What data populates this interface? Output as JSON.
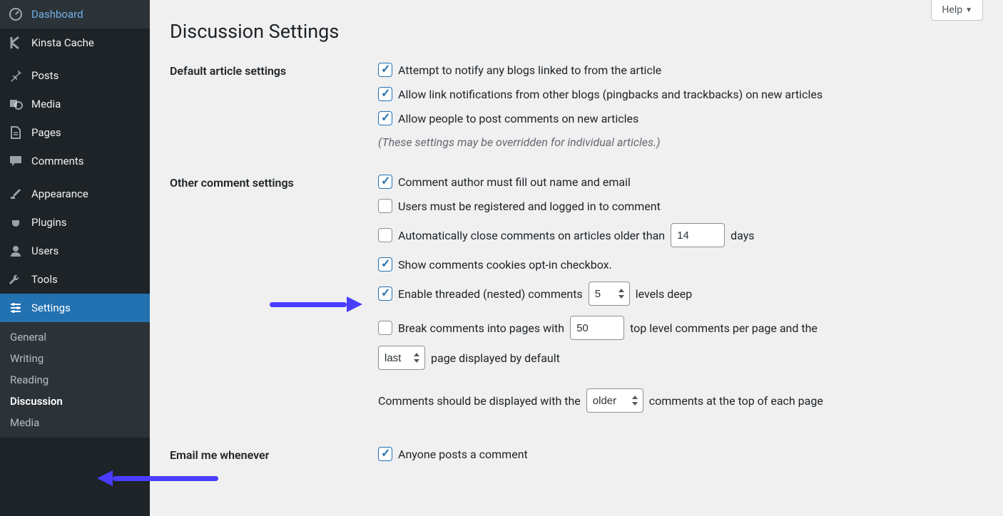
{
  "sidebar": {
    "items": [
      {
        "label": "Dashboard",
        "icon": "dashboard"
      },
      {
        "label": "Kinsta Cache",
        "icon": "kinsta"
      },
      {
        "label": "Posts",
        "icon": "pin"
      },
      {
        "label": "Media",
        "icon": "media"
      },
      {
        "label": "Pages",
        "icon": "page"
      },
      {
        "label": "Comments",
        "icon": "comment"
      },
      {
        "label": "Appearance",
        "icon": "brush"
      },
      {
        "label": "Plugins",
        "icon": "plug"
      },
      {
        "label": "Users",
        "icon": "users"
      },
      {
        "label": "Tools",
        "icon": "wrench"
      },
      {
        "label": "Settings",
        "icon": "sliders",
        "active": true
      }
    ],
    "submenu": [
      {
        "label": "General"
      },
      {
        "label": "Writing"
      },
      {
        "label": "Reading"
      },
      {
        "label": "Discussion",
        "current": true
      },
      {
        "label": "Media"
      }
    ]
  },
  "header": {
    "help": "Help",
    "title": "Discussion Settings"
  },
  "sections": {
    "default_article": {
      "heading": "Default article settings",
      "opt1": "Attempt to notify any blogs linked to from the article",
      "opt2": "Allow link notifications from other blogs (pingbacks and trackbacks) on new articles",
      "opt3": "Allow people to post comments on new articles",
      "note": "(These settings may be overridden for individual articles.)"
    },
    "other_comment": {
      "heading": "Other comment settings",
      "opt1": "Comment author must fill out name and email",
      "opt2": "Users must be registered and logged in to comment",
      "opt3_pre": "Automatically close comments on articles older than",
      "opt3_val": "14",
      "opt3_post": "days",
      "opt4": "Show comments cookies opt-in checkbox.",
      "opt5_pre": "Enable threaded (nested) comments",
      "opt5_val": "5",
      "opt5_post": "levels deep",
      "opt6_pre": "Break comments into pages with",
      "opt6_val": "50",
      "opt6_post": "top level comments per page and the",
      "opt6_sel": "last",
      "opt6_after": "page displayed by default",
      "opt7_pre": "Comments should be displayed with the",
      "opt7_sel": "older",
      "opt7_post": "comments at the top of each page"
    },
    "email": {
      "heading": "Email me whenever",
      "opt1": "Anyone posts a comment"
    }
  }
}
